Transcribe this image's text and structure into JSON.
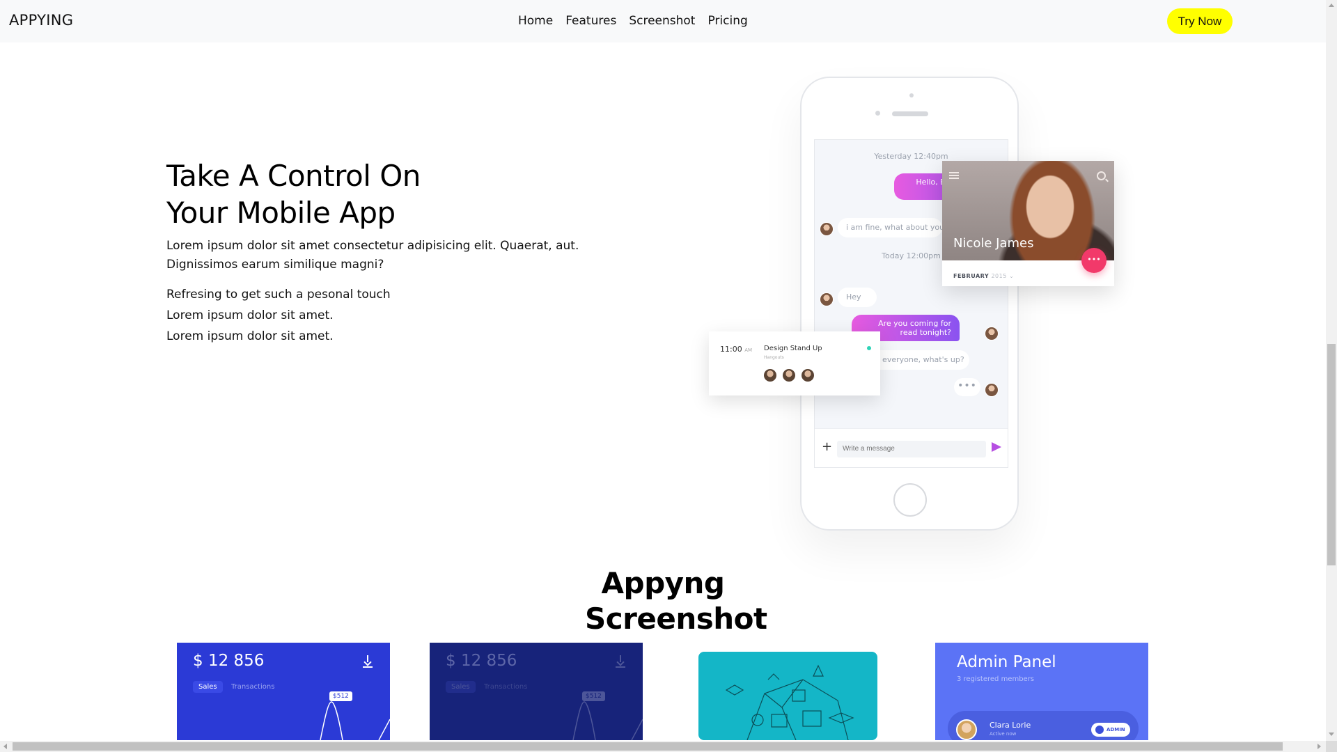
{
  "navbar": {
    "brand": "APPYING",
    "links": [
      "Home",
      "Features",
      "Screenshot",
      "Pricing"
    ],
    "cta": "Try Now",
    "cta_color": "#ffff00"
  },
  "hero": {
    "title_line1": "Take A Control On",
    "title_line2": "Your Mobile App",
    "text": "Lorem ipsum dolor sit amet consectetur adipisicing elit. Quaerat, aut. Dignissimos earum similique magni?",
    "list": [
      "Refresing to get such a pesonal touch",
      "Lorem ipsum dolor sit amet.",
      "Lorem ipsum dolor sit amet."
    ]
  },
  "phone": {
    "timestamp_1": "Yesterday 12:40pm",
    "bubble_hello": "Hello, Eve! How it's going?",
    "bubble_fine": "i am fine, what about you?",
    "timestamp_2": "Today 12:00pm",
    "bubble_hey": "Hey",
    "bubble_reading": "Are you coming for read tonight?",
    "bubble_whatsup": "Hey everyone, what's up?",
    "typing": "•••",
    "compose_placeholder": "Write a message",
    "compose_plus": "+"
  },
  "profile_card": {
    "name": "Nicole James",
    "date_month": "FEBRUARY",
    "date_year": "2015",
    "fab_label": "•••",
    "fab_color": "#f2396a"
  },
  "event_card": {
    "time": "11:00",
    "time_suffix": "AM",
    "title": "Design Stand Up",
    "subtitle": "Hangouts"
  },
  "screenshots": {
    "heading_line1": "Appyng",
    "heading_line2": "Screenshot",
    "tile_1": {
      "amount": "$ 12 856",
      "tab_active": "Sales",
      "tab_other": "Transactions",
      "price": "$512",
      "bg": "#2b3ad6"
    },
    "tile_2": {
      "amount": "$ 12 856",
      "tab_active": "Sales",
      "tab_other": "Transactions",
      "price": "$512",
      "bg": "#17237a"
    },
    "tile_4": {
      "title": "Admin Panel",
      "subtitle": "3 registered members",
      "member_name": "Clara Lorie",
      "member_status": "Active now",
      "badge": "ADMIN",
      "bg": "#5b73f6"
    }
  }
}
